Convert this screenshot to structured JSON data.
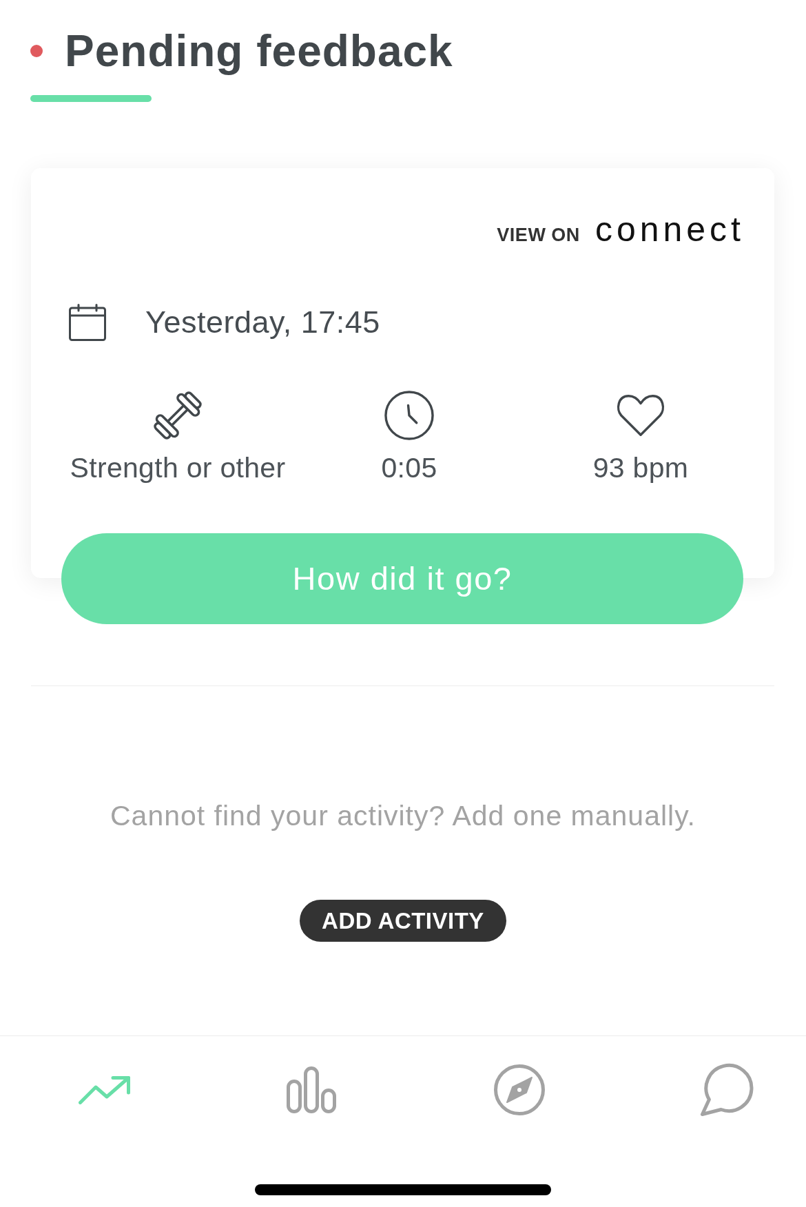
{
  "header": {
    "title": "Pending feedback",
    "unread": true
  },
  "activity": {
    "view_on": "VIEW ON",
    "brand": "connect",
    "date": "Yesterday, 17:45",
    "stats": [
      {
        "kind": "sport",
        "label": "Strength or other"
      },
      {
        "kind": "duration",
        "label": "0:05"
      },
      {
        "kind": "heart_rate",
        "label": "93 bpm"
      }
    ],
    "feedback_button": "How did it go?"
  },
  "manual": {
    "hint": "Cannot find your activity? Add one manually.",
    "button": "ADD ACTIVITY"
  },
  "tab_bar": [
    {
      "kind": "trends",
      "selected": true
    },
    {
      "kind": "statistics",
      "selected": false
    },
    {
      "kind": "explore",
      "selected": false
    },
    {
      "kind": "messages",
      "selected": false
    }
  ]
}
